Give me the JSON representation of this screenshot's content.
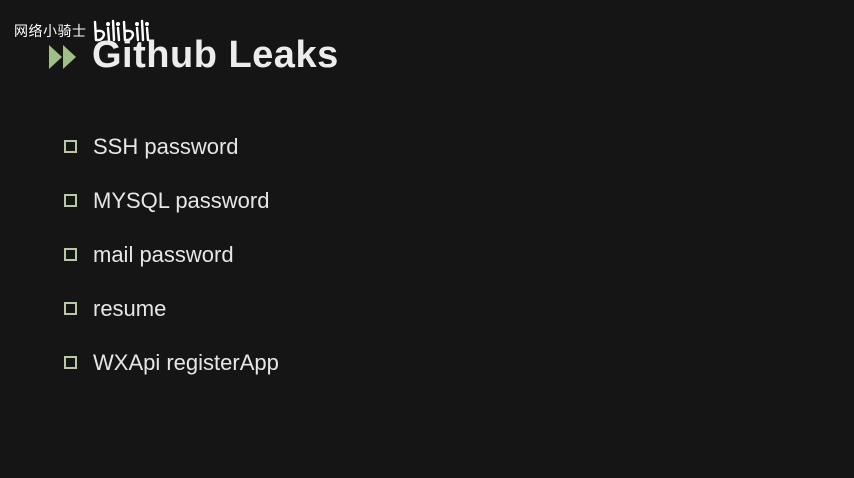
{
  "watermark": {
    "text": "网络小骑士",
    "logo_name": "bilibili"
  },
  "slide": {
    "title": "Github Leaks",
    "arrows_color": "#9fbf86",
    "bullet_color": "#b7c9a4",
    "bullets": [
      {
        "label": "SSH password"
      },
      {
        "label": "MYSQL password"
      },
      {
        "label": "mail password"
      },
      {
        "label": "resume"
      },
      {
        "label": "WXApi registerApp"
      }
    ]
  }
}
